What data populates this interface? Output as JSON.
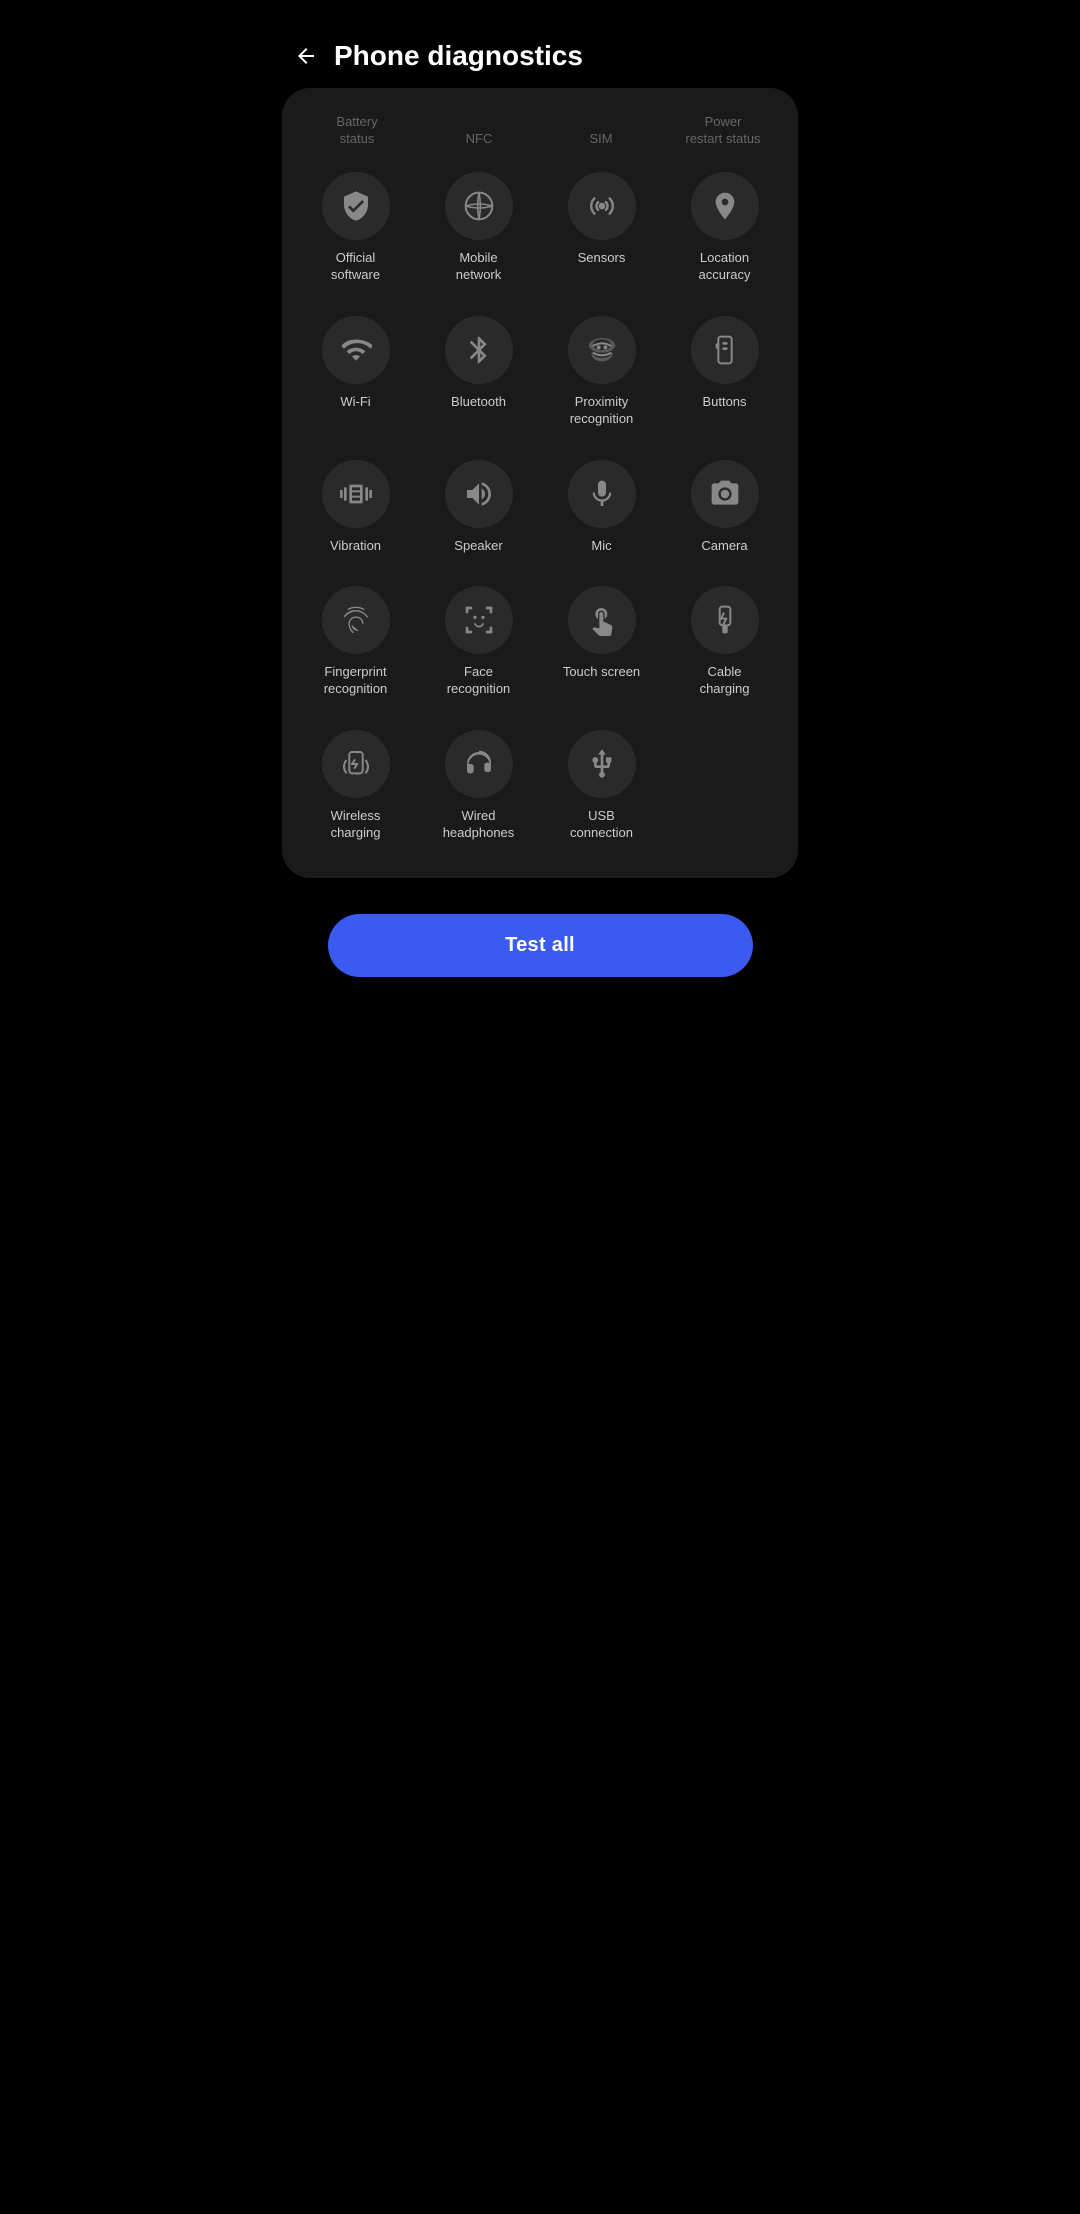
{
  "header": {
    "title": "Phone diagnostics",
    "back_label": "back"
  },
  "partial_row": {
    "items": [
      {
        "label": "Battery\nstatus"
      },
      {
        "label": "NFC"
      },
      {
        "label": "SIM"
      },
      {
        "label": "Power\nrestart status"
      }
    ]
  },
  "grid_rows": [
    {
      "items": [
        {
          "id": "official-software",
          "label": "Official\nsoftware",
          "icon": "badge"
        },
        {
          "id": "mobile-network",
          "label": "Mobile\nnetwork",
          "icon": "mobile-network"
        },
        {
          "id": "sensors",
          "label": "Sensors",
          "icon": "sensors"
        },
        {
          "id": "location-accuracy",
          "label": "Location\naccuracy",
          "icon": "location"
        }
      ]
    },
    {
      "items": [
        {
          "id": "wifi",
          "label": "Wi-Fi",
          "icon": "wifi"
        },
        {
          "id": "bluetooth",
          "label": "Bluetooth",
          "icon": "bluetooth"
        },
        {
          "id": "proximity-recognition",
          "label": "Proximity\nrecognition",
          "icon": "proximity"
        },
        {
          "id": "buttons",
          "label": "Buttons",
          "icon": "buttons"
        }
      ]
    },
    {
      "items": [
        {
          "id": "vibration",
          "label": "Vibration",
          "icon": "vibration"
        },
        {
          "id": "speaker",
          "label": "Speaker",
          "icon": "speaker"
        },
        {
          "id": "mic",
          "label": "Mic",
          "icon": "mic"
        },
        {
          "id": "camera",
          "label": "Camera",
          "icon": "camera"
        }
      ]
    },
    {
      "items": [
        {
          "id": "fingerprint-recognition",
          "label": "Fingerprint\nrecognition",
          "icon": "fingerprint"
        },
        {
          "id": "face-recognition",
          "label": "Face\nrecognition",
          "icon": "face"
        },
        {
          "id": "touch-screen",
          "label": "Touch screen",
          "icon": "touch"
        },
        {
          "id": "cable-charging",
          "label": "Cable\ncharging",
          "icon": "usb"
        }
      ]
    },
    {
      "items": [
        {
          "id": "wireless-charging",
          "label": "Wireless\ncharging",
          "icon": "wireless-charging"
        },
        {
          "id": "wired-headphones",
          "label": "Wired\nheadphones",
          "icon": "headphones"
        },
        {
          "id": "usb-connection",
          "label": "USB\nconnection",
          "icon": "usb-connection"
        }
      ]
    }
  ],
  "test_all_button": {
    "label": "Test all"
  }
}
